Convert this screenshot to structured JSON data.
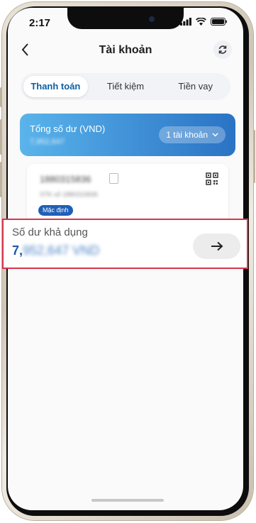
{
  "status_bar": {
    "time": "2:17"
  },
  "header": {
    "title": "Tài khoản",
    "back_icon": "chevron-left-icon",
    "refresh_icon": "refresh-icon"
  },
  "tabs": [
    {
      "label": "Thanh toán",
      "active": true
    },
    {
      "label": "Tiết kiệm",
      "active": false
    },
    {
      "label": "Tiền vay",
      "active": false
    }
  ],
  "balance_card": {
    "label": "Tổng số dư (VND)",
    "value": "7,952,647",
    "account_selector": "1 tài khoản",
    "gradient_colors": [
      "#5ab4ea",
      "#2a73c4"
    ]
  },
  "account": {
    "number": "1880315836",
    "name": "STK số 1880315836",
    "badge": "Mặc định"
  },
  "available_balance": {
    "label": "Số dư khả dụng",
    "value_prefix": "7,",
    "value_rest": "952,647 VND",
    "highlight_color": "#d8334d"
  }
}
